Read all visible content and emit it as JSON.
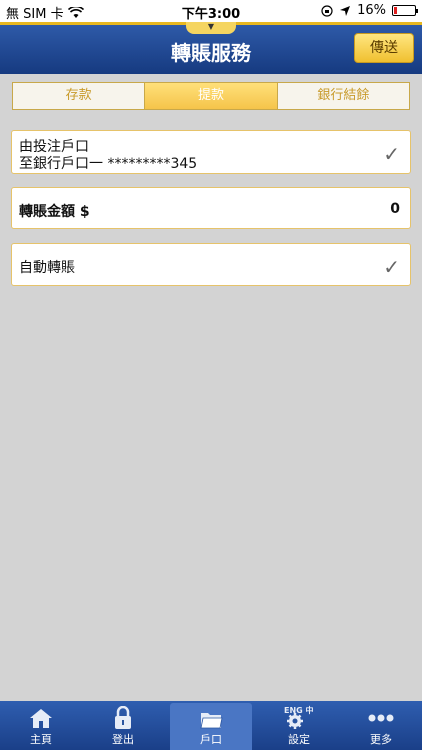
{
  "status": {
    "carrier": "無 SIM 卡",
    "time": "下午3:00",
    "battery": "16%",
    "battery_level": 0.16
  },
  "header": {
    "title": "轉賬服務",
    "send_label": "傳送"
  },
  "tabs": [
    {
      "label": "存款"
    },
    {
      "label": "提款"
    },
    {
      "label": "銀行結餘"
    }
  ],
  "account": {
    "from_label": "由投注戶口",
    "to_label": "至銀行戶口一 *********345"
  },
  "amount": {
    "label": "轉賬金額 $",
    "value": "0"
  },
  "auto_transfer": {
    "label": "自動轉賬"
  },
  "tabbar": {
    "items": [
      {
        "label": "主頁",
        "icon": "home-icon"
      },
      {
        "label": "登出",
        "icon": "lock-icon"
      },
      {
        "label": "戶口",
        "icon": "folder-icon"
      },
      {
        "label": "設定",
        "icon": "gear-icon",
        "icon_text": "ENG 中"
      },
      {
        "label": "更多",
        "icon": "more-icon"
      }
    ]
  },
  "colors": {
    "header_blue": "#1f4c9c",
    "accent_gold": "#f5c44a",
    "background": "#d3d3d3"
  }
}
